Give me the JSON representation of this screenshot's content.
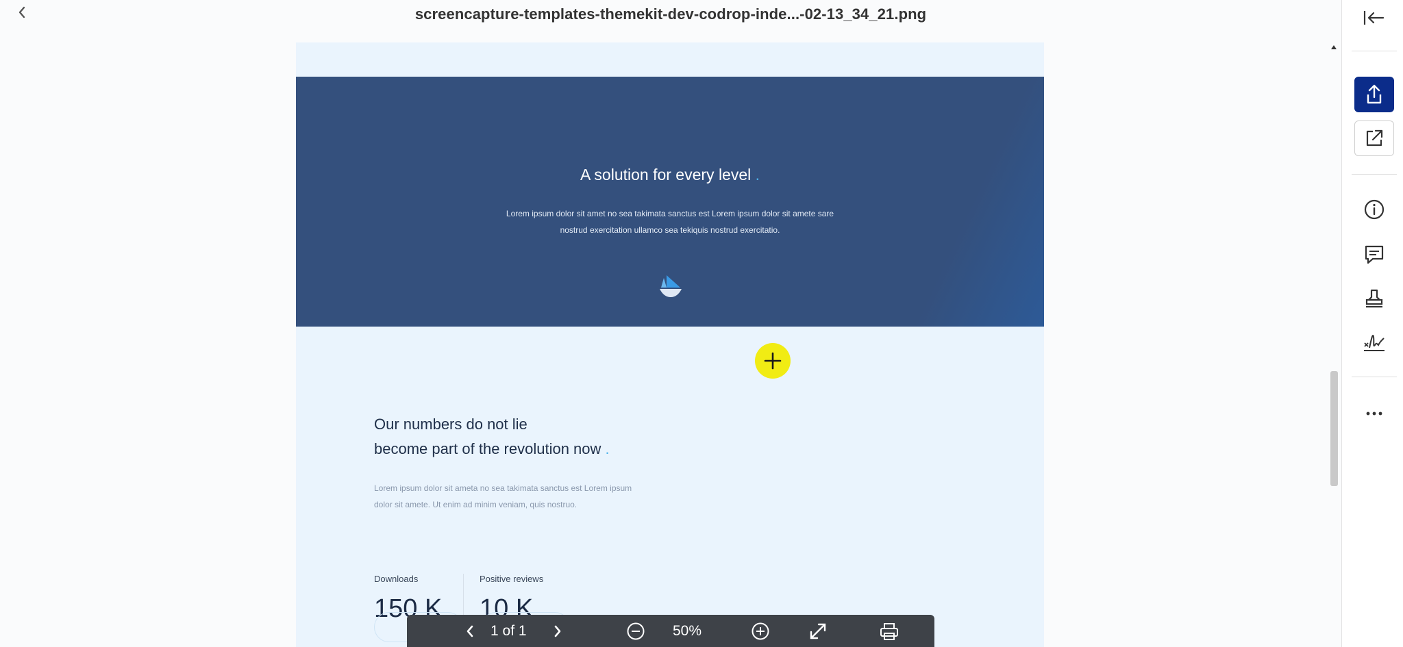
{
  "header": {
    "file_title": "screencapture-templates-themekit-dev-codrop-inde...-02-13_34_21.png",
    "back_icon": "chevron-left-icon"
  },
  "sidebar": {
    "items": [
      {
        "name": "collapse-panel-button",
        "icon": "collapse-left-icon"
      },
      {
        "name": "share-button",
        "icon": "share-icon"
      },
      {
        "name": "open-external-button",
        "icon": "open-external-icon"
      },
      {
        "name": "info-button",
        "icon": "info-icon"
      },
      {
        "name": "comment-button",
        "icon": "comment-icon"
      },
      {
        "name": "stamp-button",
        "icon": "stamp-icon"
      },
      {
        "name": "signature-button",
        "icon": "signature-icon"
      },
      {
        "name": "more-button",
        "icon": "more-icon"
      }
    ],
    "primary_color": "#0b2c8a"
  },
  "document": {
    "hero": {
      "title": "A solution for every level",
      "title_dot": ".",
      "line1": "Lorem ipsum dolor sit amet no sea takimata sanctus est Lorem ipsum dolor sit amete sare",
      "line2": "nostrud exercitation ullamco sea tekiquis nostrud exercitatio.",
      "background_color": "#34507d"
    },
    "stats": {
      "title_line1": "Our numbers do not lie",
      "title_line2": "become part of the revolution now",
      "title_dot": ".",
      "desc_line1": "Lorem ipsum dolor sit ameta no sea takimata sanctus est Lorem ipsum",
      "desc_line2": "dolor sit amete. Ut enim ad minim veniam, quis nostruo.",
      "items": [
        {
          "label": "Downloads",
          "value": "150 K"
        },
        {
          "label": "Positive reviews",
          "value": "10 K"
        }
      ],
      "accent_color": "#4fb3ea"
    }
  },
  "viewer_toolbar": {
    "page_indicator": "1 of 1",
    "zoom": "50%",
    "icons": [
      "chevron-left-icon",
      "chevron-right-icon",
      "zoom-out-icon",
      "zoom-in-icon",
      "fullscreen-icon",
      "print-icon"
    ]
  },
  "cursor_marker_color": "#f1ec14"
}
